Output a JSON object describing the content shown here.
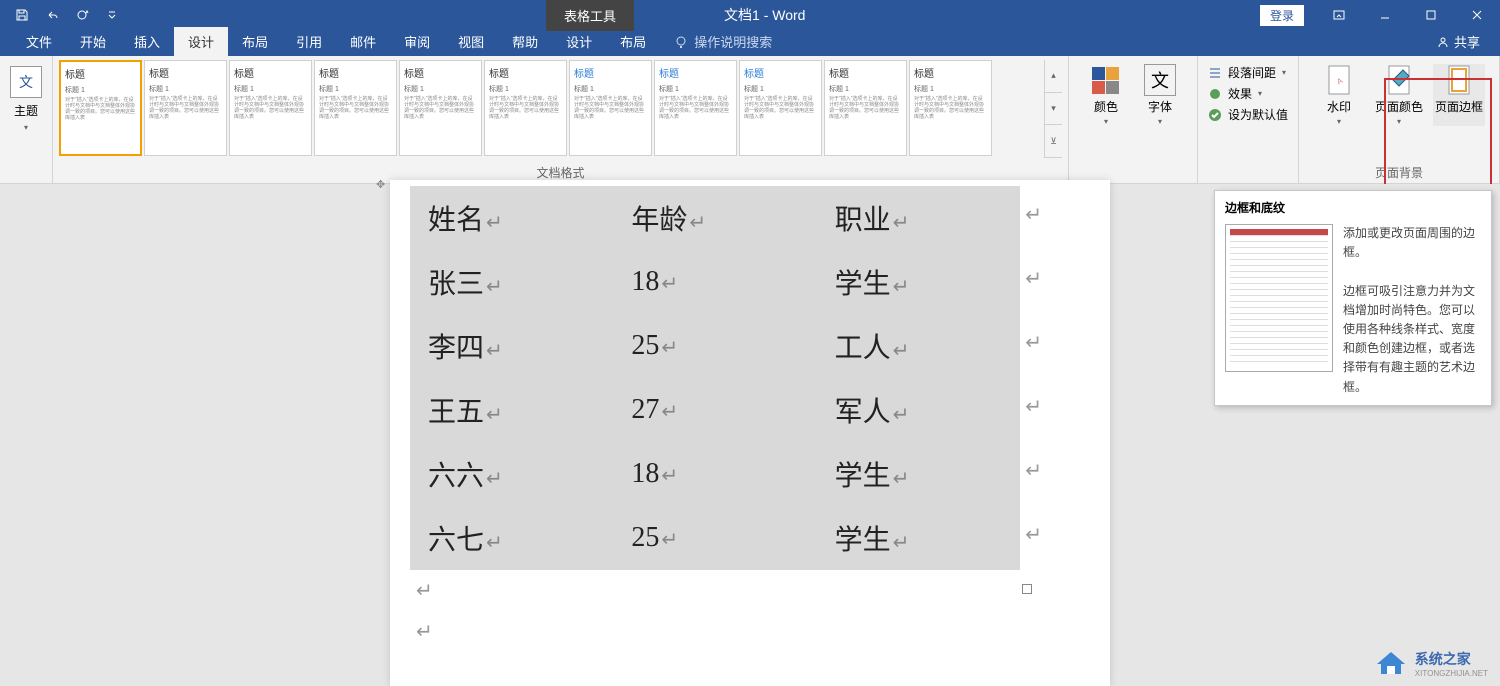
{
  "titlebar": {
    "context_tab": "表格工具",
    "doc_title": "文档1 - Word",
    "login": "登录"
  },
  "tabs": {
    "items": [
      "文件",
      "开始",
      "插入",
      "设计",
      "布局",
      "引用",
      "邮件",
      "审阅",
      "视图",
      "帮助",
      "设计",
      "布局"
    ],
    "active_index": 3,
    "tell_me": "操作说明搜索",
    "share": "共享"
  },
  "ribbon": {
    "themes_label": "主题",
    "gallery_label": "文档格式",
    "styles": [
      {
        "title": "标题",
        "sub": "标题 1"
      },
      {
        "title": "标题",
        "sub": "标题 1"
      },
      {
        "title": "标题",
        "sub": "标题 1"
      },
      {
        "title": "标题",
        "sub": "标题 1"
      },
      {
        "title": "标题",
        "sub": "标题 1"
      },
      {
        "title": "标题",
        "sub": "标题 1"
      },
      {
        "title": "标题",
        "sub": "标题 1"
      },
      {
        "title": "标题",
        "sub": "标题 1"
      },
      {
        "title": "标题",
        "sub": "标题 1"
      },
      {
        "title": "标题",
        "sub": "标题 1"
      },
      {
        "title": "标题",
        "sub": "标题 1"
      }
    ],
    "colors_label": "颜色",
    "fonts_label": "字体",
    "spacing_label": "段落间距",
    "effects_label": "效果",
    "default_label": "设为默认值",
    "watermark_label": "水印",
    "page_color_label": "页面颜色",
    "page_border_label": "页面边框",
    "bg_group_label": "页面背景"
  },
  "table": {
    "headers": [
      "姓名",
      "年龄",
      "职业"
    ],
    "rows": [
      [
        "张三",
        "18",
        "学生"
      ],
      [
        "李四",
        "25",
        "工人"
      ],
      [
        "王五",
        "27",
        "军人"
      ],
      [
        "六六",
        "18",
        "学生"
      ],
      [
        "六七",
        "25",
        "学生"
      ]
    ]
  },
  "tooltip": {
    "title": "边框和底纹",
    "p1": "添加或更改页面周围的边框。",
    "p2": "边框可吸引注意力并为文档增加时尚特色。您可以使用各种线条样式、宽度和颜色创建边框，或者选择带有有趣主题的艺术边框。"
  },
  "watermark": {
    "name": "系统之家",
    "url": "XITONGZHIJIA.NET"
  }
}
